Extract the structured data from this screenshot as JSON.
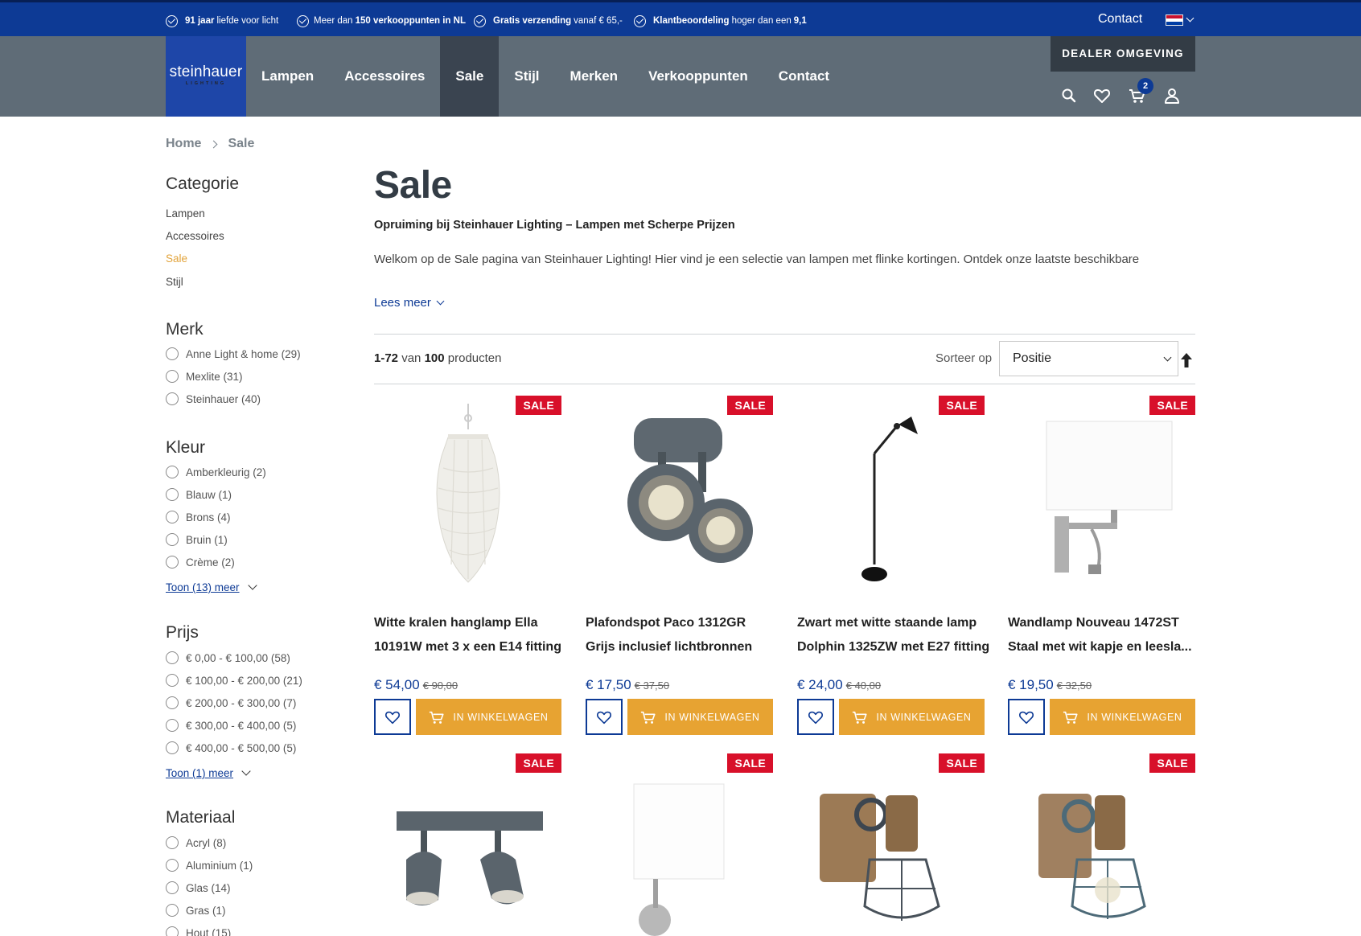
{
  "topbar": {
    "usps": [
      {
        "bold_pre": "91 jaar",
        "text": "liefde voor licht",
        "bold_post": ""
      },
      {
        "bold_pre": "",
        "text": "Meer dan",
        "bold_post": "150 verkooppunten in NL"
      },
      {
        "bold_pre": "Gratis verzending",
        "text": "vanaf € 65,-",
        "bold_post": ""
      },
      {
        "bold_pre": "Klantbeoordeling",
        "text": "hoger dan een",
        "bold_post": "9,1"
      }
    ],
    "contact": "Contact"
  },
  "header": {
    "logo_name": "steinhauer",
    "logo_sub": "LIGHTING",
    "nav": [
      "Lampen",
      "Accessoires",
      "Sale",
      "Stijl",
      "Merken",
      "Verkooppunten",
      "Contact"
    ],
    "dealer": "DEALER OMGEVING",
    "cart_count": "2"
  },
  "breadcrumb": [
    "Home",
    "Sale"
  ],
  "sidebar": {
    "categorie": {
      "title": "Categorie",
      "items": [
        "Lampen",
        "Accessoires",
        "Sale",
        "Stijl"
      ]
    },
    "merk": {
      "title": "Merk",
      "options": [
        "Anne Light & home (29)",
        "Mexlite (31)",
        "Steinhauer (40)"
      ]
    },
    "kleur": {
      "title": "Kleur",
      "options": [
        "Amberkleurig (2)",
        "Blauw (1)",
        "Brons (4)",
        "Bruin (1)",
        "Crème (2)"
      ],
      "more": "Toon (13) meer"
    },
    "prijs": {
      "title": "Prijs",
      "options": [
        "€ 0,00 - € 100,00 (58)",
        "€ 100,00 - € 200,00 (21)",
        "€ 200,00 - € 300,00 (7)",
        "€ 300,00 - € 400,00 (5)",
        "€ 400,00 - € 500,00 (5)"
      ],
      "more": "Toon (1) meer"
    },
    "materiaal": {
      "title": "Materiaal",
      "options": [
        "Acryl (8)",
        "Aluminium (1)",
        "Glas (14)",
        "Gras (1)",
        "Hout (15)"
      ]
    }
  },
  "main": {
    "title": "Sale",
    "subtitle": "Opruiming bij Steinhauer Lighting – Lampen met Scherpe Prijzen",
    "intro": "Welkom op de Sale pagina van Steinhauer Lighting! Hier vind je een selectie van lampen met flinke kortingen. Ontdek onze laatste beschikbare",
    "read_more": "Lees meer",
    "count_range": "1-72",
    "count_of": "van",
    "count_total": "100",
    "count_unit": "producten",
    "sort_label": "Sorteer op",
    "sort_value": "Positie"
  },
  "products": [
    {
      "badge": "SALE",
      "title": "Witte kralen hanglamp Ella 10191W met 3 x een E14 fitting",
      "price": "€ 54,00",
      "old_price": "€ 90,00",
      "cart": "IN WINKELWAGEN"
    },
    {
      "badge": "SALE",
      "title": "Plafondspot Paco 1312GR Grijs inclusief lichtbronnen",
      "price": "€ 17,50",
      "old_price": "€ 37,50",
      "cart": "IN WINKELWAGEN"
    },
    {
      "badge": "SALE",
      "title": "Zwart met witte staande lamp Dolphin 1325ZW met E27 fitting",
      "price": "€ 24,00",
      "old_price": "€ 40,00",
      "cart": "IN WINKELWAGEN"
    },
    {
      "badge": "SALE",
      "title": "Wandlamp Nouveau 1472ST Staal met wit kapje en leesla...",
      "price": "€ 19,50",
      "old_price": "€ 32,50",
      "cart": "IN WINKELWAGEN"
    },
    {
      "badge": "SALE"
    },
    {
      "badge": "SALE"
    },
    {
      "badge": "SALE"
    },
    {
      "badge": "SALE"
    }
  ],
  "colors": {
    "brand_blue": "#0d3a95",
    "header_grey": "#5f6c77",
    "sale_red": "#d8102a",
    "cart_orange": "#e7a332",
    "active_category": "#e2a33a"
  }
}
